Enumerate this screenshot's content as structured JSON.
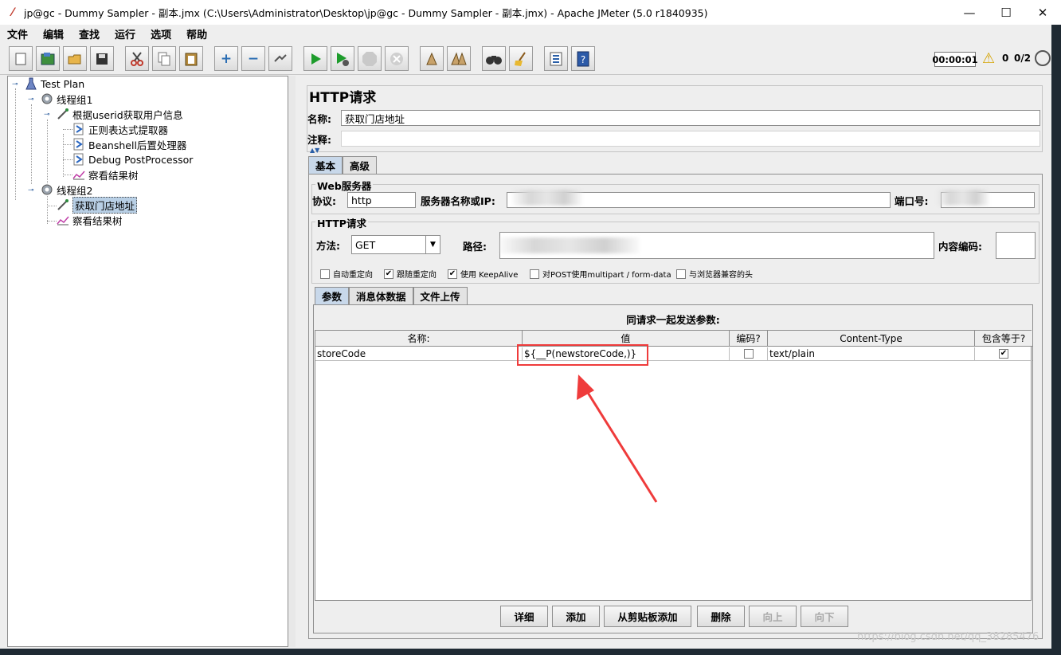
{
  "window": {
    "title": "jp@gc - Dummy Sampler - 副本.jmx (C:\\Users\\Administrator\\Desktop\\jp@gc - Dummy Sampler - 副本.jmx) - Apache JMeter (5.0 r1840935)",
    "minimize": "—",
    "maximize": "☐",
    "close": "✕"
  },
  "menu": [
    "文件",
    "编辑",
    "查找",
    "运行",
    "选项",
    "帮助"
  ],
  "toolbar": {
    "timer": "00:00:01",
    "warning_count": "0",
    "threads": "0/2"
  },
  "tree": {
    "nodes": [
      {
        "label": "Test Plan",
        "icon": "flask-icon"
      },
      {
        "label": "线程组1",
        "icon": "gear-icon"
      },
      {
        "label": "根据userid获取用户信息",
        "icon": "pipette-icon"
      },
      {
        "label": "正则表达式提取器",
        "icon": "post-processor-icon"
      },
      {
        "label": "Beanshell后置处理器",
        "icon": "post-processor-icon"
      },
      {
        "label": "Debug PostProcessor",
        "icon": "post-processor-icon"
      },
      {
        "label": "察看结果树",
        "icon": "listener-icon"
      },
      {
        "label": "线程组2",
        "icon": "gear-icon"
      },
      {
        "label": "获取门店地址",
        "icon": "pipette-icon"
      },
      {
        "label": "察看结果树",
        "icon": "listener-icon"
      }
    ]
  },
  "panel": {
    "title": "HTTP请求",
    "name_label": "名称:",
    "name_value": "获取门店地址",
    "comment_label": "注释:",
    "comment_value": "",
    "tabs": [
      "基本",
      "高级"
    ],
    "web_server": {
      "group_title": "Web服务器",
      "protocol_label": "协议:",
      "protocol_value": "http",
      "server_label": "服务器名称或IP:",
      "port_label": "端口号:"
    },
    "http_request": {
      "group_title": "HTTP请求",
      "method_label": "方法:",
      "method_value": "GET",
      "path_label": "路径:",
      "encoding_label": "内容编码:",
      "checkboxes": [
        {
          "label": "自动重定向",
          "checked": false
        },
        {
          "label": "跟随重定向",
          "checked": true
        },
        {
          "label": "使用 KeepAlive",
          "checked": true
        },
        {
          "label": "对POST使用multipart / form-data",
          "checked": false
        },
        {
          "label": "与浏览器兼容的头",
          "checked": false
        }
      ]
    },
    "sub_tabs": [
      "参数",
      "消息体数据",
      "文件上传"
    ],
    "params": {
      "caption": "同请求一起发送参数:",
      "columns": [
        "名称:",
        "值",
        "编码?",
        "Content-Type",
        "包含等于?"
      ],
      "rows": [
        {
          "name": "storeCode",
          "value": "${__P(newstoreCode,)}",
          "encode": false,
          "content_type": "text/plain",
          "include_equals": true
        }
      ]
    },
    "buttons": [
      {
        "label": "详细",
        "enabled": true
      },
      {
        "label": "添加",
        "enabled": true
      },
      {
        "label": "从剪贴板添加",
        "enabled": true
      },
      {
        "label": "删除",
        "enabled": true
      },
      {
        "label": "向上",
        "enabled": false
      },
      {
        "label": "向下",
        "enabled": false
      }
    ]
  },
  "watermark": "https://blog.csdn.net/qq_38285476",
  "colors": {
    "annotation": "#ef3b3b",
    "selection": "#b8cfe5",
    "active_tab": "#c8d8ea"
  }
}
